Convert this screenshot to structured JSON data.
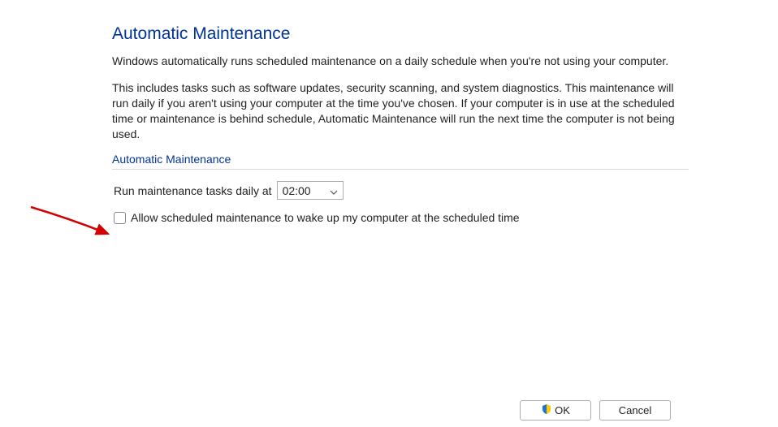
{
  "heading": "Automatic Maintenance",
  "intro1": "Windows automatically runs scheduled maintenance on a daily schedule when you're not using your computer.",
  "intro2": "This includes tasks such as software updates, security scanning, and system diagnostics. This maintenance will run daily if you aren't using your computer at the time you've chosen. If your computer is in use at the scheduled time or maintenance is behind schedule, Automatic Maintenance will run the next time the computer is not being used.",
  "section_heading": "Automatic Maintenance",
  "run_label": "Run maintenance tasks daily at",
  "time_value": "02:00",
  "wake_label": "Allow scheduled maintenance to wake up my computer at the scheduled time",
  "wake_checked": false,
  "buttons": {
    "ok": "OK",
    "cancel": "Cancel"
  }
}
